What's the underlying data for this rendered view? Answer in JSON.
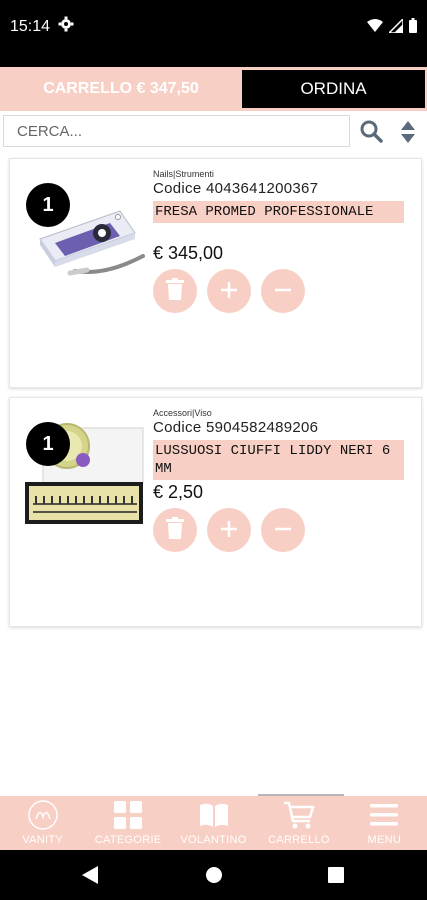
{
  "status_bar": {
    "time": "15:14"
  },
  "cart": {
    "total_label": "CARRELLO € 347,50",
    "order_label": "ORDINA"
  },
  "search": {
    "placeholder": "CERCA..."
  },
  "products": [
    {
      "quantity": "1",
      "category": "Nails|Strumenti",
      "code": "Codice 4043641200367",
      "name": "FRESA PROMED PROFESSIONALE",
      "price": "€ 345,00"
    },
    {
      "quantity": "1",
      "category": "Accessori|Viso",
      "code": "Codice 5904582489206",
      "name": "LUSSUOSI CIUFFI LIDDY NERI 6 MM",
      "price": "€ 2,50"
    }
  ],
  "bottom_nav": {
    "items": [
      {
        "label": "VANITY",
        "icon": "vanity-logo-icon"
      },
      {
        "label": "CATEGORIE",
        "icon": "grid-icon"
      },
      {
        "label": "VOLANTINO",
        "icon": "book-icon"
      },
      {
        "label": "CARRELLO",
        "icon": "cart-icon"
      },
      {
        "label": "MENU",
        "icon": "hamburger-icon"
      }
    ],
    "active": "CARRELLO"
  },
  "colors": {
    "accent": "#f8cfc5",
    "dark": "#000000"
  }
}
